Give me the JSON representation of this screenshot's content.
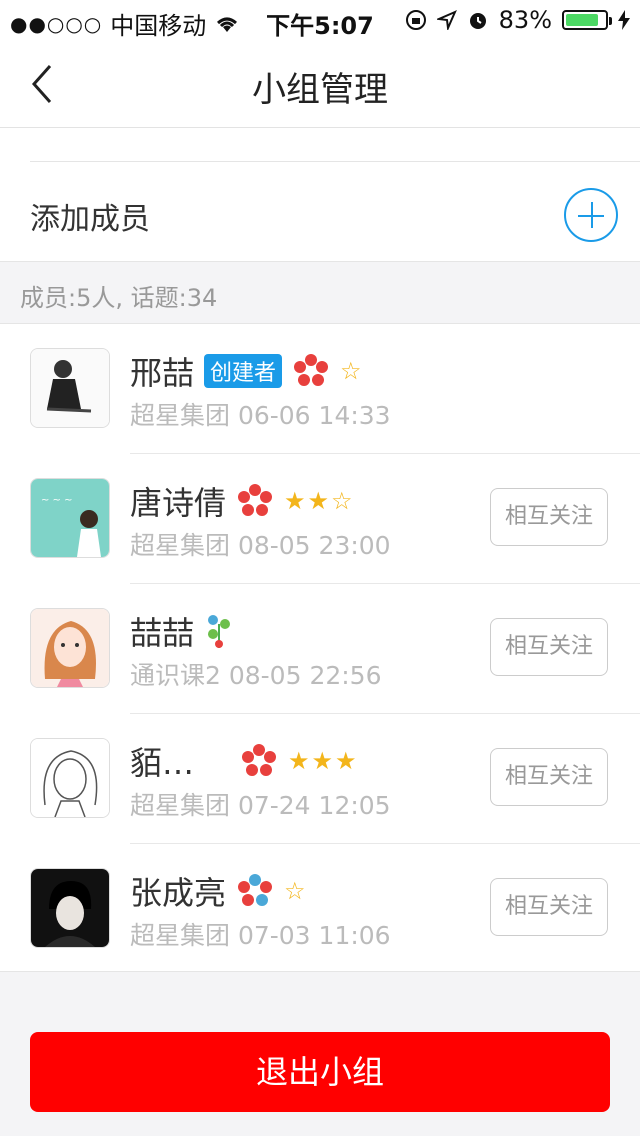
{
  "status_bar": {
    "carrier": "中国移动",
    "time": "下午5:07",
    "battery_text": "83%",
    "battery_level": 0.83
  },
  "navbar": {
    "title": "小组管理",
    "back_icon": "chevron-left-icon"
  },
  "add_member": {
    "label": "添加成员",
    "icon": "plus-circle-icon"
  },
  "summary": {
    "text": "成员:5人, 话题:34"
  },
  "members": [
    {
      "name": "邢喆",
      "badge": "创建者",
      "sub": "超星集团  06-06 14:33",
      "stars_full": 0,
      "stars_total": 1,
      "follow": ""
    },
    {
      "name": "唐诗倩",
      "badge": "",
      "sub": "超星集团  08-05 23:00",
      "stars_full": 2,
      "stars_total": 3,
      "follow": "相互关注"
    },
    {
      "name": "喆喆",
      "badge": "",
      "sub": "通识课2  08-05 22:56",
      "stars_full": 0,
      "stars_total": 0,
      "follow": "相互关注"
    },
    {
      "name": "貊…",
      "badge": "",
      "sub": "超星集团  07-24 12:05",
      "stars_full": 3,
      "stars_total": 3,
      "follow": "相互关注"
    },
    {
      "name": "张成亮",
      "badge": "",
      "sub": "超星集团  07-03 11:06",
      "stars_full": 0,
      "stars_total": 1,
      "follow": "相互关注"
    }
  ],
  "exit_button": {
    "label": "退出小组",
    "color": "#ff0000"
  }
}
